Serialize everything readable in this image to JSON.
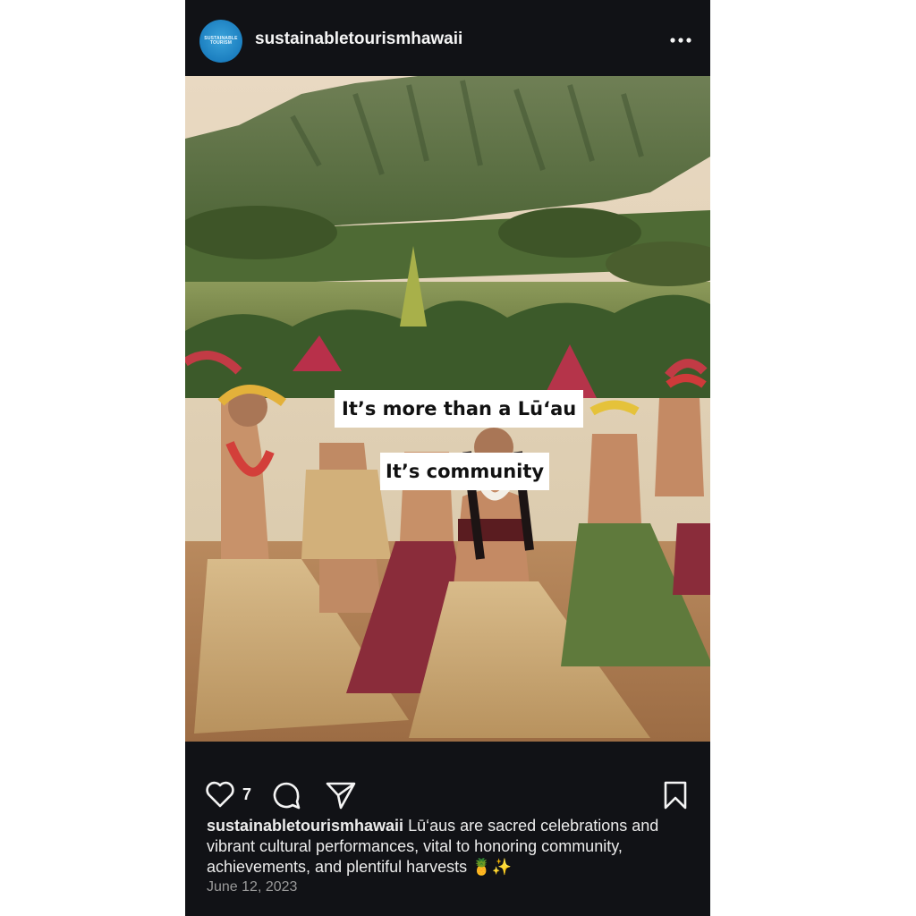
{
  "post": {
    "username": "sustainabletourismhawaii",
    "avatar_text": "SUSTAINABLE TOURISM",
    "more_icon": "more-horizontal-icon",
    "overlay_line1": "It’s more than a  Lū‘au",
    "overlay_line2": "It’s community",
    "like_count": "7",
    "caption_user": "sustainabletourismhawaii",
    "caption_text": "Lū‘aus are sacred celebrations and vibrant cultural performances, vital to honoring community, achievements, and plentiful harvests 🍍✨",
    "date": "June 12, 2023"
  },
  "icons": {
    "like": "heart-icon",
    "comment": "comment-icon",
    "share": "send-icon",
    "save": "bookmark-icon"
  },
  "colors": {
    "background": "#111216",
    "text": "#f2f2f2",
    "avatar": "#1c7fc0"
  }
}
